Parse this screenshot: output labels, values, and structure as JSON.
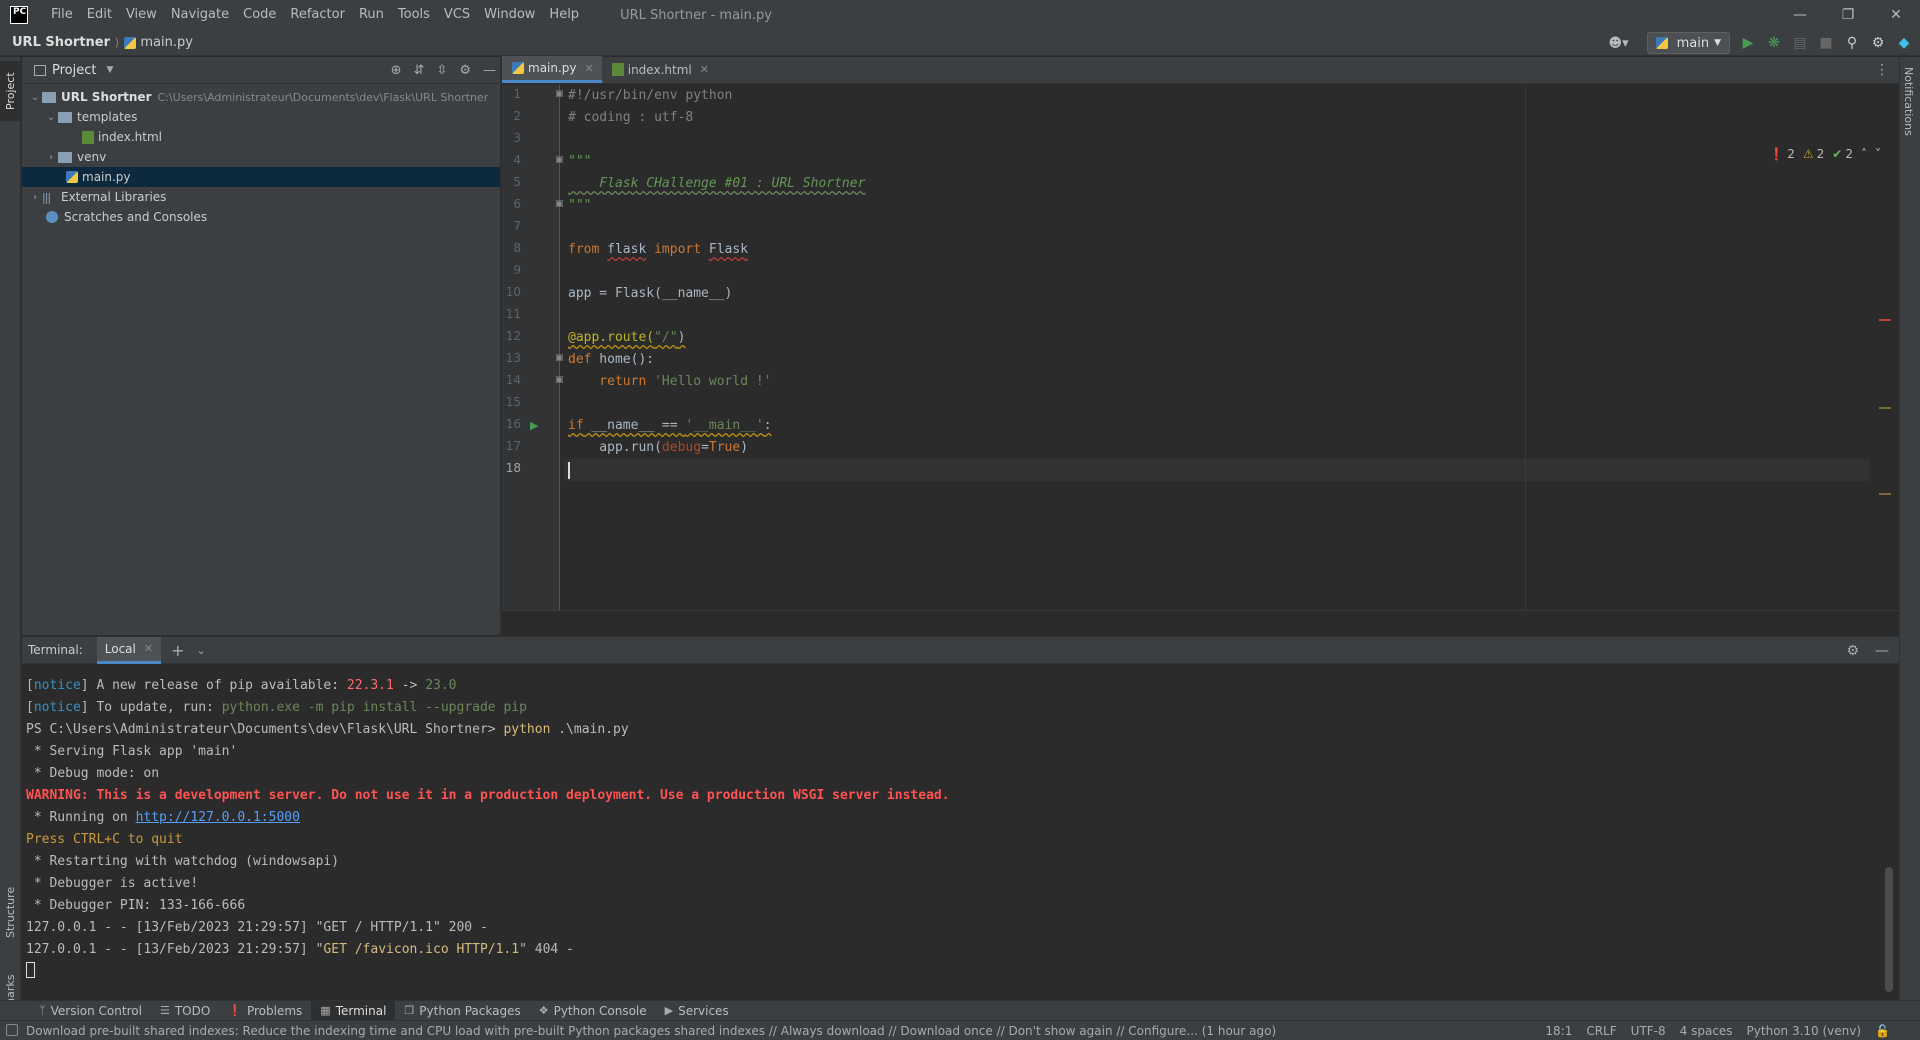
{
  "titlebar": {
    "logo": "PC",
    "menu": [
      "File",
      "Edit",
      "View",
      "Navigate",
      "Code",
      "Refactor",
      "Run",
      "Tools",
      "VCS",
      "Window",
      "Help"
    ],
    "window_title": "URL Shortner - main.py"
  },
  "navbar": {
    "project": "URL Shortner",
    "file": "main.py",
    "run_config": "main"
  },
  "stripes": {
    "project": "Project",
    "structure": "Structure",
    "bookmarks": "Bookmarks",
    "notifications": "Notifications"
  },
  "project_panel": {
    "title": "Project",
    "tree": {
      "root": "URL Shortner",
      "root_path": "C:\\Users\\Administrateur\\Documents\\dev\\Flask\\URL Shortner",
      "templates": "templates",
      "index_html": "index.html",
      "venv": "venv",
      "main_py": "main.py",
      "external_libraries": "External Libraries",
      "scratches": "Scratches and Consoles"
    }
  },
  "editor": {
    "tabs": [
      {
        "label": "main.py",
        "active": true
      },
      {
        "label": "index.html",
        "active": false
      }
    ],
    "line_numbers": [
      "1",
      "2",
      "3",
      "4",
      "5",
      "6",
      "7",
      "8",
      "9",
      "10",
      "11",
      "12",
      "13",
      "14",
      "15",
      "16",
      "17",
      "18"
    ],
    "code": {
      "l1": "#!/usr/bin/env python",
      "l2": "# coding : utf-8",
      "l4": "\"\"\"",
      "l5": "    Flask CHallenge #01 : URL Shortner",
      "l6": "\"\"\"",
      "l8_kw1": "from",
      "l8_mod": "flask",
      "l8_kw2": "import",
      "l8_cls": "Flask",
      "l10": "app = Flask(__name__)",
      "l12_dec": "@app.route(",
      "l12_str": "\"/\"",
      "l12_end": ")",
      "l13_kw": "def",
      "l13_rest": " home():",
      "l14_kw": "    return",
      "l14_str": " 'Hello world !'",
      "l16_kw": "if",
      "l16_rest": " __name__ == ",
      "l16_str": "'__main__'",
      "l16_end": ":",
      "l17_a": "    app.run(",
      "l17_param": "debug",
      "l17_eq": "=",
      "l17_kw": "True",
      "l17_end": ")"
    },
    "inspections": {
      "errors": "2",
      "warnings": "2",
      "ok": "2"
    }
  },
  "terminal": {
    "title": "Terminal:",
    "tab": "Local",
    "lines": {
      "n1_open": "[",
      "n1_tag": "notice",
      "n1_close": "]",
      "n1_text": " A new release of pip available: ",
      "n1_old": "22.3.1",
      "n1_arrow": " -> ",
      "n1_new": "23.0",
      "n2_open": "[",
      "n2_tag": "notice",
      "n2_close": "]",
      "n2_text": " To update, run: ",
      "n2_cmd": "python.exe -m pip install --upgrade pip",
      "ps_prompt": "PS C:\\Users\\Administrateur\\Documents\\dev\\Flask\\URL Shortner> ",
      "ps_cmd": "python",
      "ps_arg": " .\\main.py",
      "serving": " * Serving Flask app 'main'",
      "debug": " * Debug mode: on",
      "warning": "WARNING: This is a development server. Do not use it in a production deployment. Use a production WSGI server instead.",
      "running_pre": " * Running on ",
      "running_url": "http://127.0.0.1:5000",
      "quit": "Press CTRL+C to quit",
      "restart": " * Restarting with watchdog (windowsapi)",
      "debugger": " * Debugger is active!",
      "pin": " * Debugger PIN: 133-166-666",
      "get1": "127.0.0.1 - - [13/Feb/2023 21:29:57] \"GET / HTTP/1.1\" 200 -",
      "get2_pre": "127.0.0.1 - - [13/Feb/2023 21:29:57] \"",
      "get2_req": "GET /favicon.ico HTTP/1.1",
      "get2_post": "\" 404 -"
    }
  },
  "tool_windows": [
    {
      "label": "Version Control",
      "icon": "branch-icon"
    },
    {
      "label": "TODO",
      "icon": "list-icon"
    },
    {
      "label": "Problems",
      "icon": "problems-icon"
    },
    {
      "label": "Terminal",
      "icon": "terminal-icon"
    },
    {
      "label": "Python Packages",
      "icon": "packages-icon"
    },
    {
      "label": "Python Console",
      "icon": "console-icon"
    },
    {
      "label": "Services",
      "icon": "services-icon"
    }
  ],
  "statusbar": {
    "message": "Download pre-built shared indexes: Reduce the indexing time and CPU load with pre-built Python packages shared indexes // Always download // Download once // Don't show again // Configure... (1 hour ago)",
    "position": "18:1",
    "line_sep": "CRLF",
    "encoding": "UTF-8",
    "indent": "4 spaces",
    "interpreter": "Python 3.10 (venv)"
  }
}
